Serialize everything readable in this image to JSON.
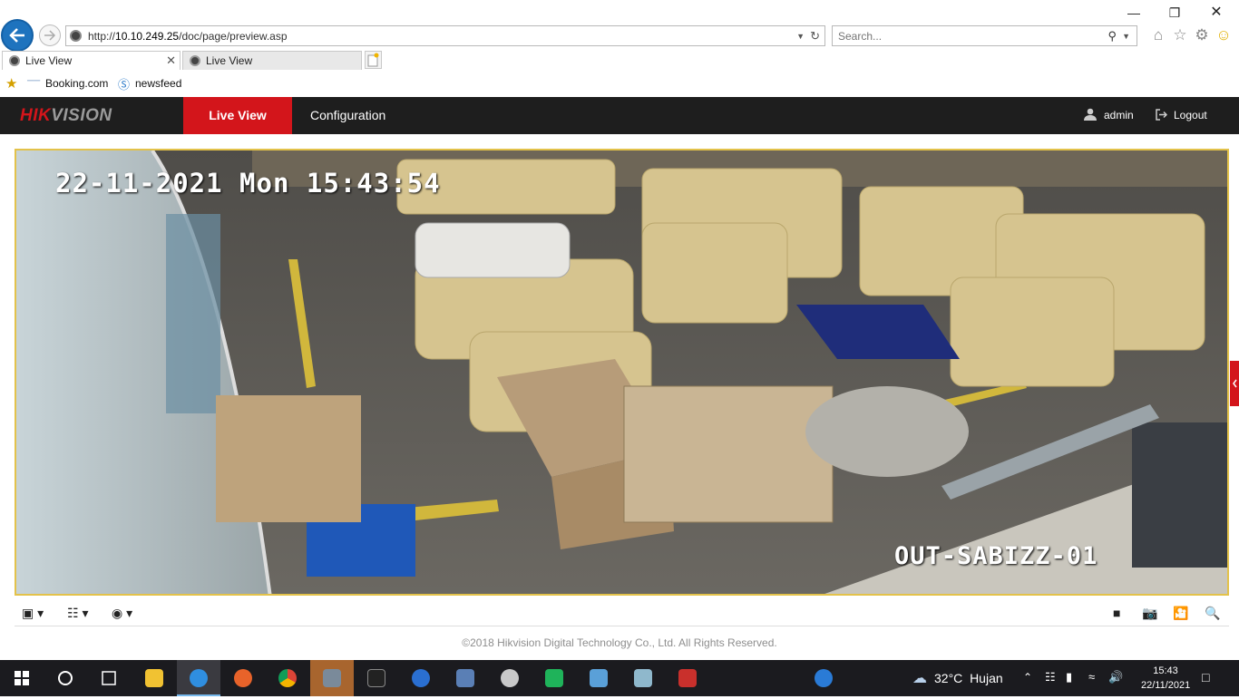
{
  "browser": {
    "url_prefix": "http://",
    "url_host": "10.10.249.25",
    "url_path": "/doc/page/preview.asp",
    "search_placeholder": "Search...",
    "tabs": [
      {
        "label": "Live View",
        "active": true
      },
      {
        "label": "Live View",
        "active": false
      }
    ],
    "favorites": [
      {
        "label": "Booking.com"
      },
      {
        "label": "newsfeed"
      }
    ]
  },
  "app": {
    "logo_part1": "HIK",
    "logo_part2": "VISION",
    "nav": [
      {
        "label": "Live View",
        "active": true
      },
      {
        "label": "Configuration",
        "active": false
      }
    ],
    "user": "admin",
    "logout": "Logout",
    "accent_color": "#d3151b"
  },
  "video": {
    "osd_datetime": "22-11-2021 Mon 15:43:54",
    "osd_camera_name": "OUT-SABIZZ-01"
  },
  "footer": {
    "copyright": "©2018 Hikvision Digital Technology Co., Ltd. All Rights Reserved."
  },
  "taskbar": {
    "weather_temp": "32°C",
    "weather_label": "Hujan",
    "time": "15:43",
    "date": "22/11/2021"
  }
}
